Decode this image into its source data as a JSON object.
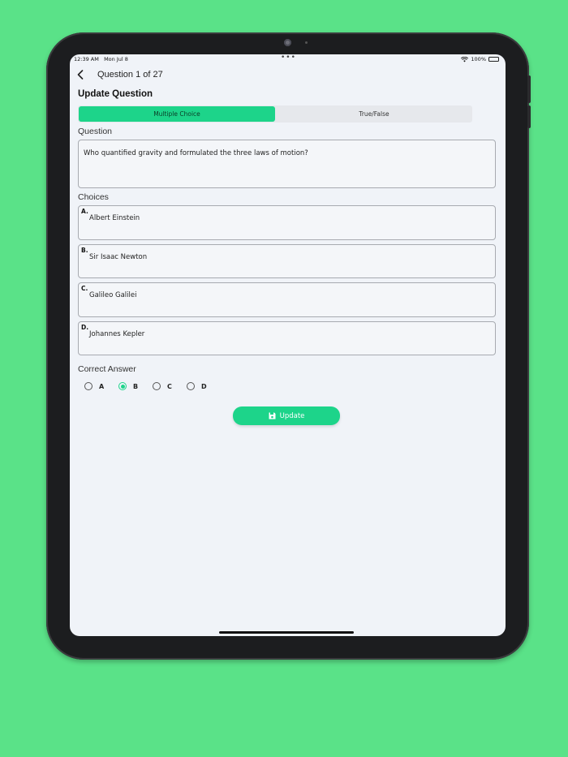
{
  "statusbar": {
    "time": "12:39 AM",
    "date": "Mon Jul 8",
    "dots": "•••",
    "battery": "100%"
  },
  "nav": {
    "title": "Question 1 of 27"
  },
  "heading": "Update Question",
  "tabs": [
    {
      "label": "Multiple Choice",
      "active": true
    },
    {
      "label": "True/False",
      "active": false
    }
  ],
  "question": {
    "label": "Question",
    "value": "Who quantified gravity and formulated the three laws of motion?"
  },
  "choices": {
    "label": "Choices",
    "items": [
      {
        "letter": "A.",
        "value": "Albert Einstein"
      },
      {
        "letter": "B.",
        "value": "Sir Isaac Newton"
      },
      {
        "letter": "C.",
        "value": "Galileo Galilei"
      },
      {
        "letter": "D.",
        "value": "Johannes Kepler"
      }
    ]
  },
  "answer": {
    "label": "Correct Answer",
    "options": [
      "A",
      "B",
      "C",
      "D"
    ],
    "selected": "B"
  },
  "update_label": "Update",
  "colors": {
    "accent": "#1dd48a",
    "background": "#5ae288",
    "screen": "#f0f3f8"
  }
}
